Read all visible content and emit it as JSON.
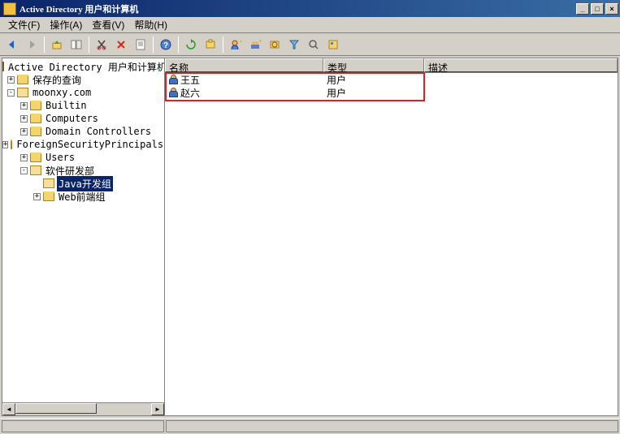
{
  "title": "Active Directory 用户和计算机",
  "menu": {
    "file": "文件(F)",
    "action": "操作(A)",
    "view": "查看(V)",
    "help": "帮助(H)"
  },
  "winbtns": {
    "min": "_",
    "max": "□",
    "close": "×"
  },
  "tree": {
    "root": "Active Directory 用户和计算机",
    "saved_queries": "保存的查询",
    "domain": "moonxy.com",
    "builtin": "Builtin",
    "computers": "Computers",
    "domain_controllers": "Domain Controllers",
    "fsp": "ForeignSecurityPrincipals",
    "users": "Users",
    "dept": "软件研发部",
    "java_group": "Java开发组",
    "web_group": "Web前端组"
  },
  "expanders": {
    "plus": "+",
    "minus": "-"
  },
  "columns": {
    "name": "名称",
    "type": "类型",
    "desc": "描述"
  },
  "rows": [
    {
      "name": "王五",
      "type": "用户",
      "desc": ""
    },
    {
      "name": "赵六",
      "type": "用户",
      "desc": ""
    }
  ],
  "scroll": {
    "left": "◄",
    "right": "►"
  }
}
